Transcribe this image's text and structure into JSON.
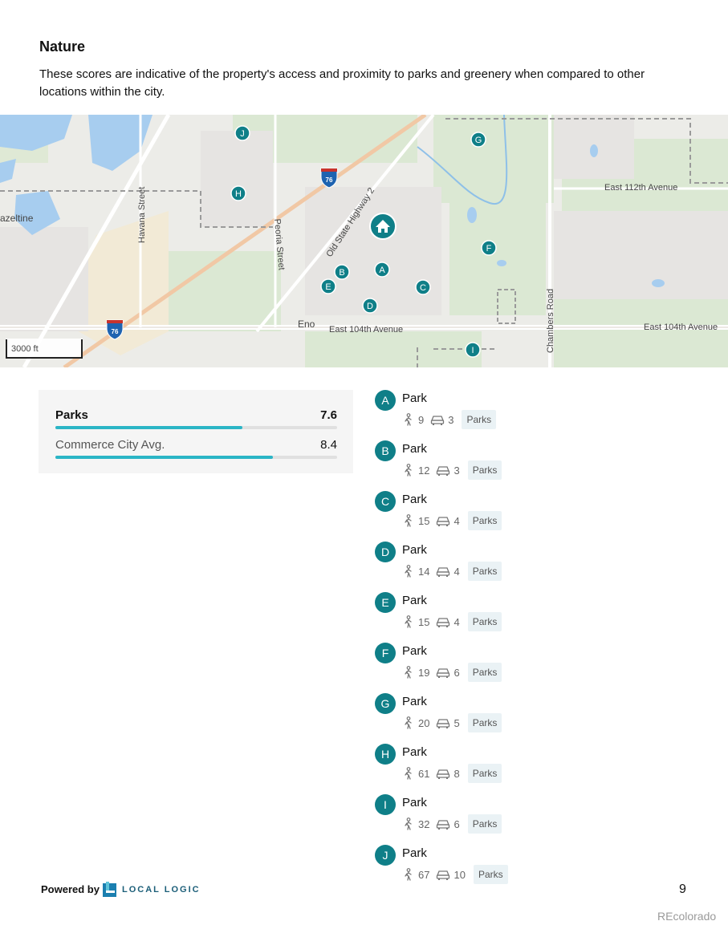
{
  "section": {
    "title": "Nature",
    "description": "These scores are indicative of the property's access and proximity to parks and greenery when compared to other locations within the city."
  },
  "map": {
    "labels": {
      "havana": "Havana Street",
      "peoria": "Peoria Street",
      "old_hwy": "Old State Highway 2",
      "chambers": "Chambers Road",
      "e112": "East 112th Avenue",
      "e104_left": "East 104th Avenue",
      "e104_right": "East 104th Avenue",
      "eno": "Eno",
      "hazeltine": "azeltine",
      "i76_top": "76",
      "i76_bottom": "76"
    },
    "scale": "3000 ft",
    "markers": [
      "A",
      "B",
      "C",
      "D",
      "E",
      "F",
      "G",
      "H",
      "I",
      "J"
    ],
    "marker_color": "#0f7f88",
    "home_icon": "home-icon"
  },
  "scores": {
    "parks": {
      "label": "Parks",
      "value": "7.6",
      "fraction": 0.76
    },
    "city_avg": {
      "label": "Commerce City Avg.",
      "value": "8.4",
      "fraction": 0.84
    }
  },
  "parks": [
    {
      "letter": "A",
      "name": "Park",
      "walk": "9",
      "drive": "3",
      "tag": "Parks"
    },
    {
      "letter": "B",
      "name": "Park",
      "walk": "12",
      "drive": "3",
      "tag": "Parks"
    },
    {
      "letter": "C",
      "name": "Park",
      "walk": "15",
      "drive": "4",
      "tag": "Parks"
    },
    {
      "letter": "D",
      "name": "Park",
      "walk": "14",
      "drive": "4",
      "tag": "Parks"
    },
    {
      "letter": "E",
      "name": "Park",
      "walk": "15",
      "drive": "4",
      "tag": "Parks"
    },
    {
      "letter": "F",
      "name": "Park",
      "walk": "19",
      "drive": "6",
      "tag": "Parks"
    },
    {
      "letter": "G",
      "name": "Park",
      "walk": "20",
      "drive": "5",
      "tag": "Parks"
    },
    {
      "letter": "H",
      "name": "Park",
      "walk": "61",
      "drive": "8",
      "tag": "Parks"
    },
    {
      "letter": "I",
      "name": "Park",
      "walk": "32",
      "drive": "6",
      "tag": "Parks"
    },
    {
      "letter": "J",
      "name": "Park",
      "walk": "67",
      "drive": "10",
      "tag": "Parks"
    }
  ],
  "footer": {
    "powered_by": "Powered by",
    "brand": "LOCAL LOGIC",
    "page_number": "9",
    "watermark": "REcolorado"
  }
}
